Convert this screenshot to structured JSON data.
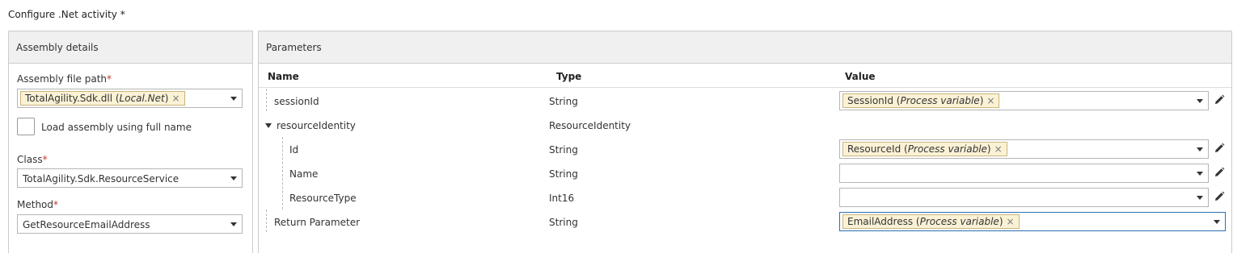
{
  "window": {
    "title": "Configure .Net activity *"
  },
  "assembly": {
    "header": "Assembly details",
    "file_path_label": "Assembly file path",
    "file_path_chip": "TotalAgility.Sdk.dll",
    "file_path_chip_source": "Local.Net",
    "load_full_name_label": "Load assembly using full name",
    "load_full_name_checked": false,
    "class_label": "Class",
    "class_value": "TotalAgility.Sdk.ResourceService",
    "method_label": "Method",
    "method_value": "GetResourceEmailAddress",
    "required_mark": "*"
  },
  "parameters": {
    "header": "Parameters",
    "columns": {
      "name": "Name",
      "type": "Type",
      "value": "Value"
    },
    "rows": [
      {
        "name": "sessionId",
        "type": "String",
        "chip": "SessionId",
        "chip_source": "Process variable"
      },
      {
        "name": "resourceIdentity",
        "type": "ResourceIdentity"
      },
      {
        "name": "Id",
        "type": "String",
        "chip": "ResourceId",
        "chip_source": "Process variable"
      },
      {
        "name": "Name",
        "type": "String"
      },
      {
        "name": "ResourceType",
        "type": "Int16"
      },
      {
        "name": "Return Parameter",
        "type": "String",
        "chip": "EmailAddress",
        "chip_source": "Process variable"
      }
    ]
  },
  "icons": {
    "remove": "close-icon",
    "edit": "pencil-icon",
    "dropdown": "chevron-down-icon",
    "expand": "triangle-down-icon"
  },
  "colors": {
    "chip_bg": "#fbf2d6",
    "chip_border": "#c9b57c",
    "header_bg": "#f0f0f0",
    "required": "#c0392b",
    "focus_border": "#2c6fb3"
  }
}
